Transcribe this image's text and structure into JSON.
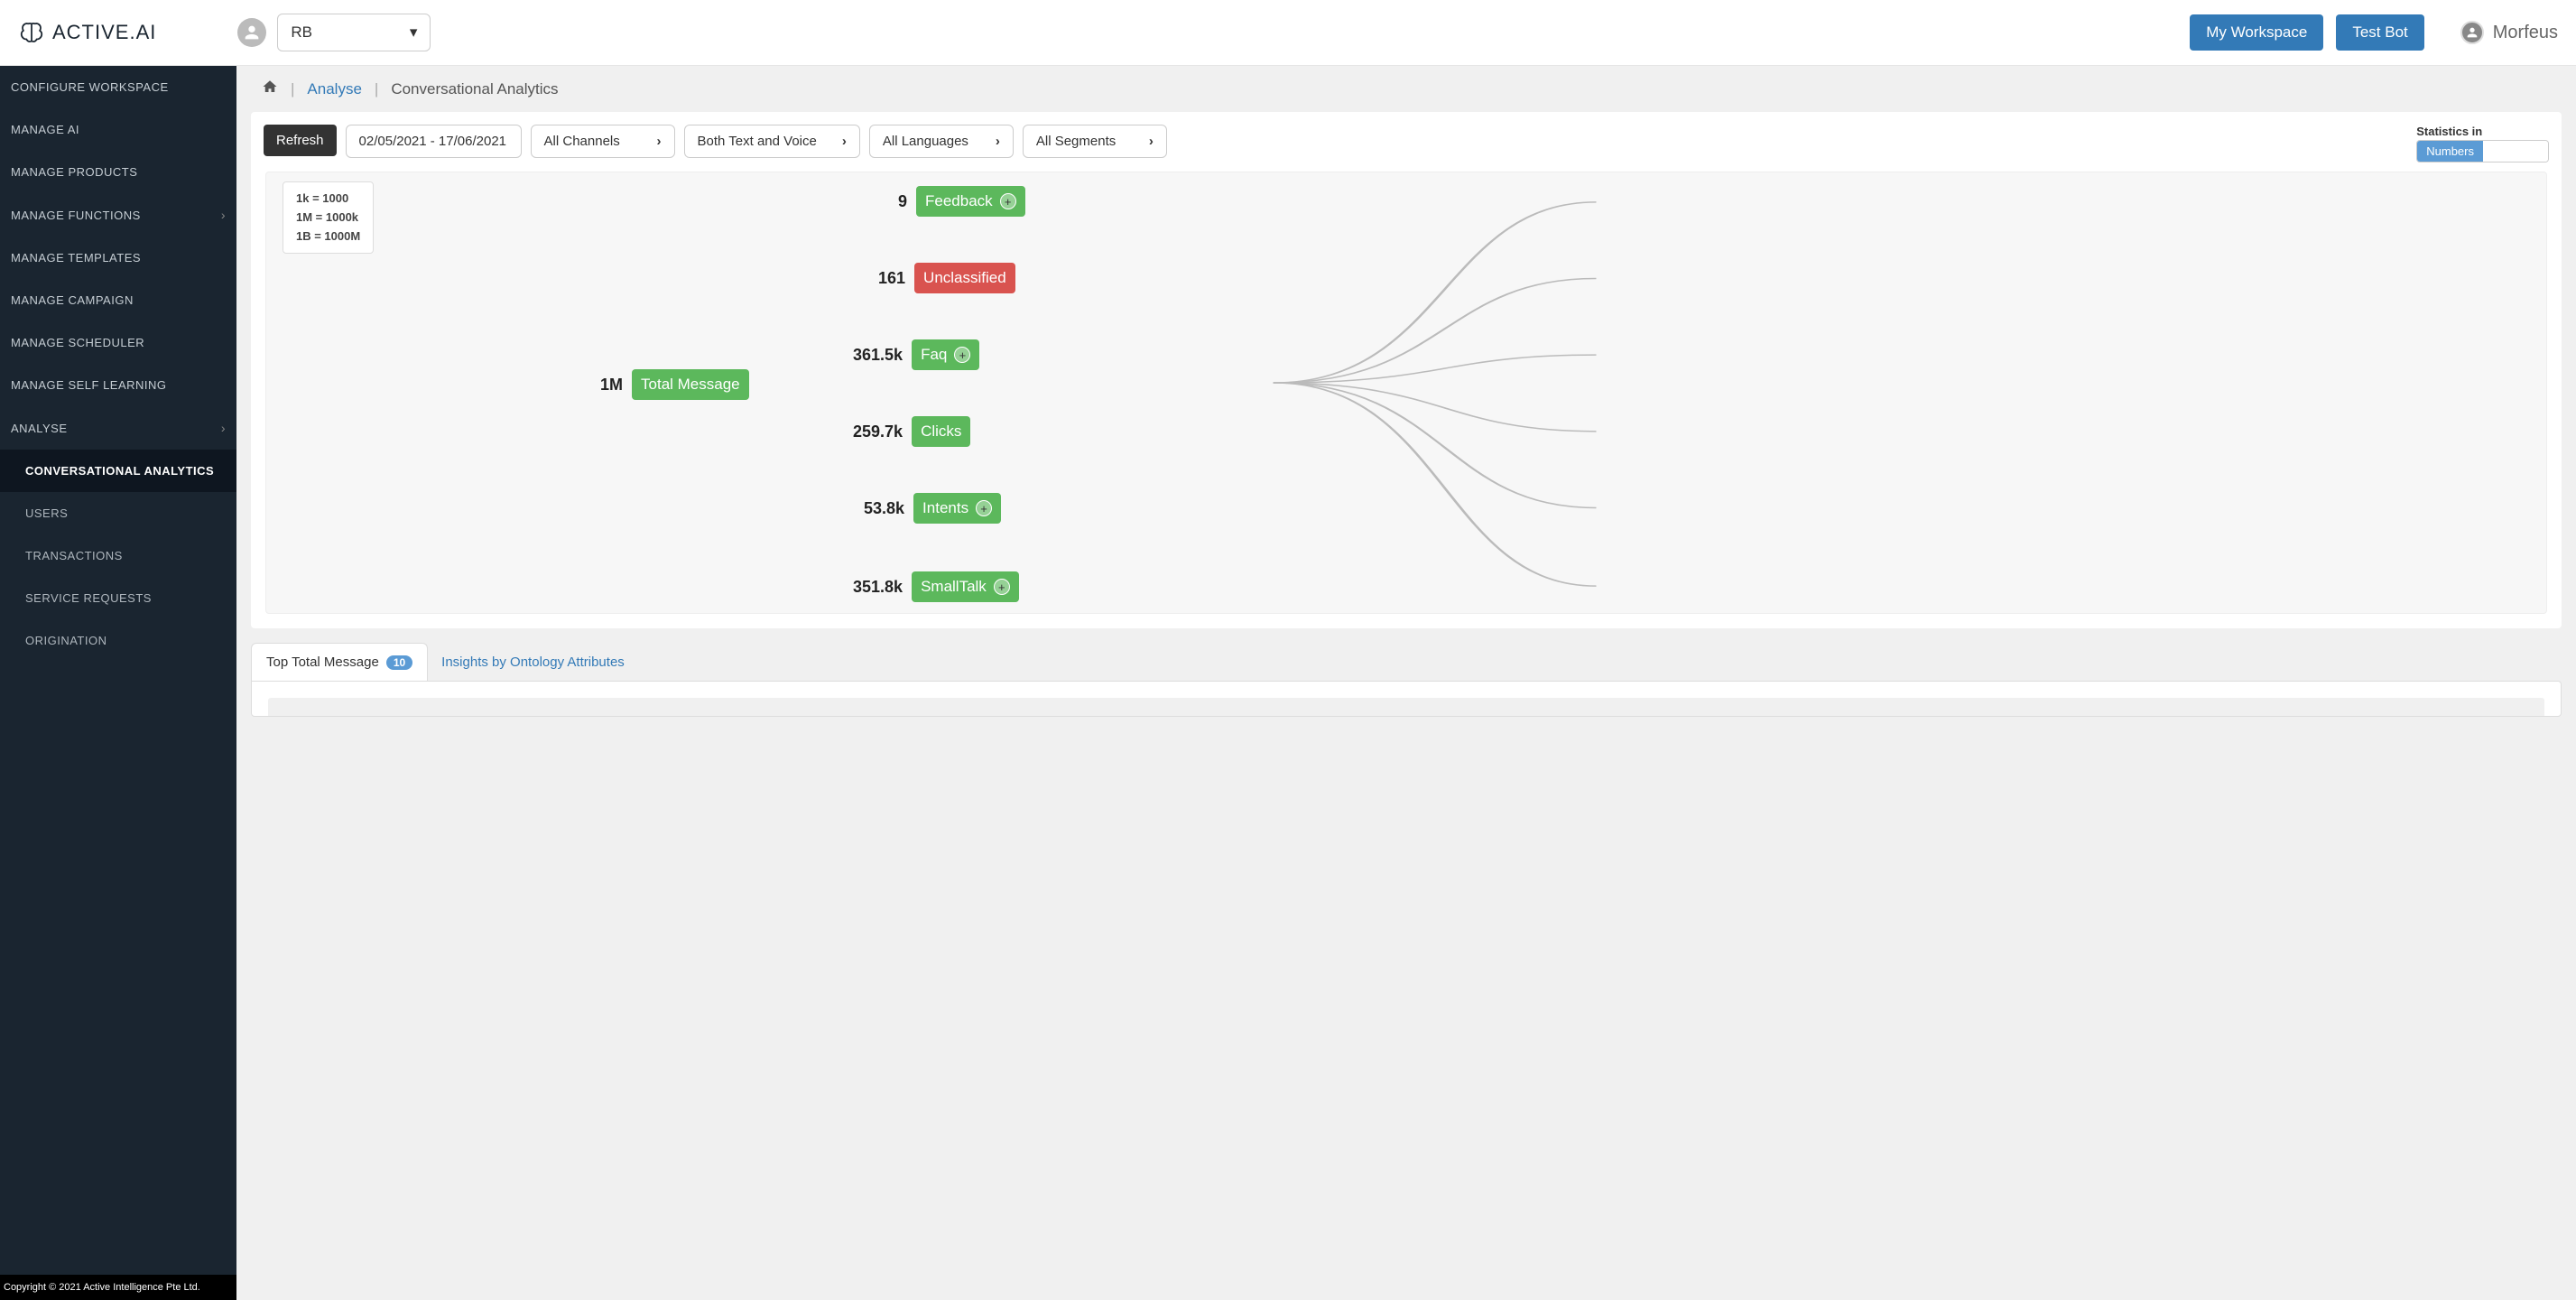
{
  "brand": "ACTIVE.AI",
  "org_selector": "RB",
  "header": {
    "my_workspace": "My Workspace",
    "test_bot": "Test Bot",
    "user": "Morfeus"
  },
  "sidebar": {
    "items": [
      "CONFIGURE WORKSPACE",
      "MANAGE AI",
      "MANAGE PRODUCTS",
      "MANAGE FUNCTIONS",
      "MANAGE TEMPLATES",
      "MANAGE CAMPAIGN",
      "MANAGE SCHEDULER",
      "MANAGE SELF LEARNING",
      "ANALYSE"
    ],
    "subitems": [
      "CONVERSATIONAL ANALYTICS",
      "USERS",
      "TRANSACTIONS",
      "SERVICE REQUESTS",
      "ORIGINATION"
    ],
    "copyright": "Copyright © 2021 Active Intelligence Pte Ltd."
  },
  "breadcrumb": {
    "l1": "Analyse",
    "l2": "Conversational Analytics"
  },
  "filters": {
    "refresh": "Refresh",
    "daterange": "02/05/2021 - 17/06/2021",
    "channels": "All Channels",
    "mode": "Both Text and Voice",
    "languages": "All Languages",
    "segments": "All Segments",
    "stats_label": "Statistics in",
    "stats_opt1": "Numbers"
  },
  "legend": {
    "l1": "1k = 1000",
    "l2": "1M = 1000k",
    "l3": "1B = 1000M"
  },
  "chart_data": {
    "type": "tree",
    "root": {
      "label": "Total Message",
      "value": "1M",
      "color": "green"
    },
    "children": [
      {
        "label": "Feedback",
        "value": "9",
        "color": "green",
        "expandable": true
      },
      {
        "label": "Unclassified",
        "value": "161",
        "color": "red",
        "expandable": false
      },
      {
        "label": "Faq",
        "value": "361.5k",
        "color": "green",
        "expandable": true
      },
      {
        "label": "Clicks",
        "value": "259.7k",
        "color": "green",
        "expandable": false
      },
      {
        "label": "Intents",
        "value": "53.8k",
        "color": "green",
        "expandable": true
      },
      {
        "label": "SmallTalk",
        "value": "351.8k",
        "color": "green",
        "expandable": true
      }
    ]
  },
  "tabs": {
    "t1": "Top Total Message",
    "t1_badge": "10",
    "t2": "Insights by Ontology Attributes"
  }
}
